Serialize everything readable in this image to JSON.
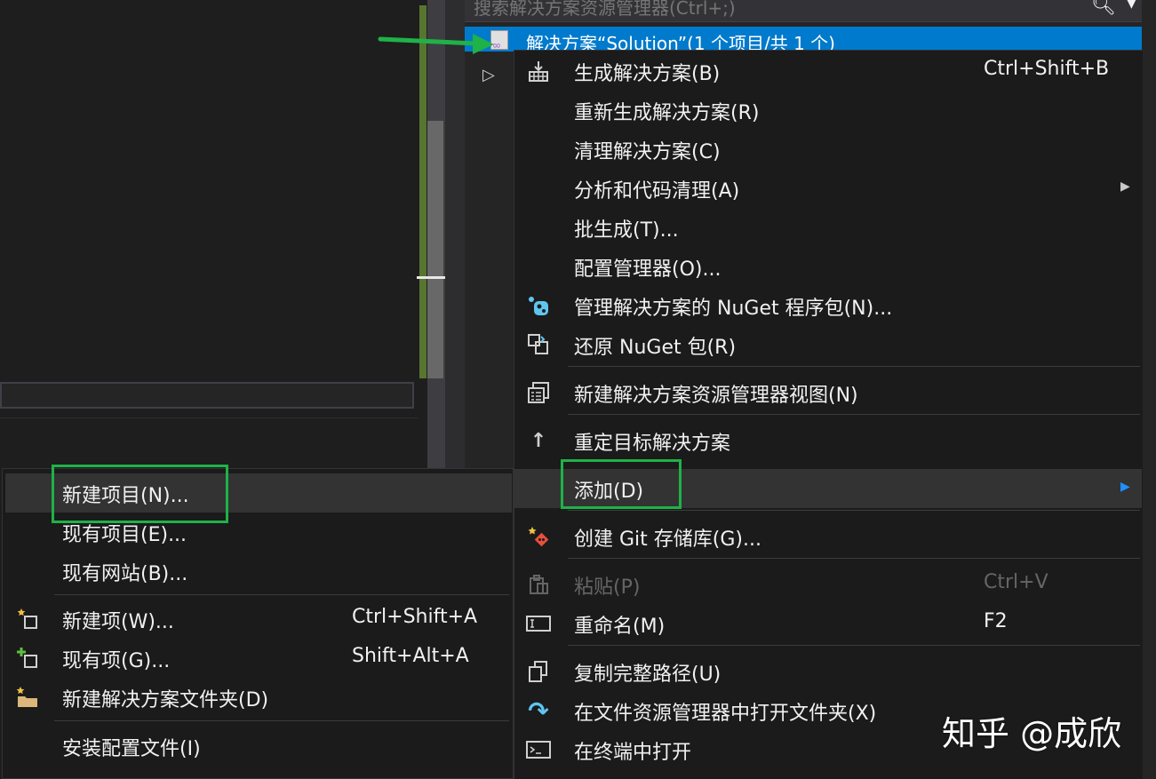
{
  "search": {
    "placeholder": "搜索解决方案资源管理器(Ctrl+;)"
  },
  "solution": {
    "label": "解决方案“Solution”(1 个项目/共 1 个)"
  },
  "main_menu": {
    "build": {
      "label": "生成解决方案(B)",
      "shortcut": "Ctrl+Shift+B"
    },
    "rebuild": {
      "label": "重新生成解决方案(R)"
    },
    "clean": {
      "label": "清理解决方案(C)"
    },
    "analyze": {
      "label": "分析和代码清理(A)"
    },
    "batch": {
      "label": "批生成(T)..."
    },
    "config": {
      "label": "配置管理器(O)..."
    },
    "nuget_manage": {
      "label": "管理解决方案的 NuGet 程序包(N)..."
    },
    "nuget_restore": {
      "label": "还原 NuGet 包(R)"
    },
    "new_view": {
      "label": "新建解决方案资源管理器视图(N)"
    },
    "retarget": {
      "label": "重定目标解决方案"
    },
    "add": {
      "label": "添加(D)"
    },
    "git": {
      "label": "创建 Git 存储库(G)..."
    },
    "paste": {
      "label": "粘贴(P)",
      "shortcut": "Ctrl+V"
    },
    "rename": {
      "label": "重命名(M)",
      "shortcut": "F2"
    },
    "copy_path": {
      "label": "复制完整路径(U)"
    },
    "open_folder": {
      "label": "在文件资源管理器中打开文件夹(X)"
    },
    "open_terminal": {
      "label": "在终端中打开"
    }
  },
  "sub_menu": {
    "new_project": {
      "label": "新建项目(N)..."
    },
    "existing_project": {
      "label": "现有项目(E)..."
    },
    "existing_website": {
      "label": "现有网站(B)..."
    },
    "new_item": {
      "label": "新建项(W)...",
      "shortcut": "Ctrl+Shift+A"
    },
    "existing_item": {
      "label": "现有项(G)...",
      "shortcut": "Shift+Alt+A"
    },
    "new_folder": {
      "label": "新建解决方案文件夹(D)"
    },
    "install_config": {
      "label": "安装配置文件(I)"
    }
  },
  "watermark": {
    "text": "知乎 @成欣"
  },
  "colors": {
    "selection": "#007acc",
    "highlight_box": "#1fb248",
    "menu_bg": "#1b1b1c",
    "submenu_arrow_active": "#1e90ff"
  }
}
